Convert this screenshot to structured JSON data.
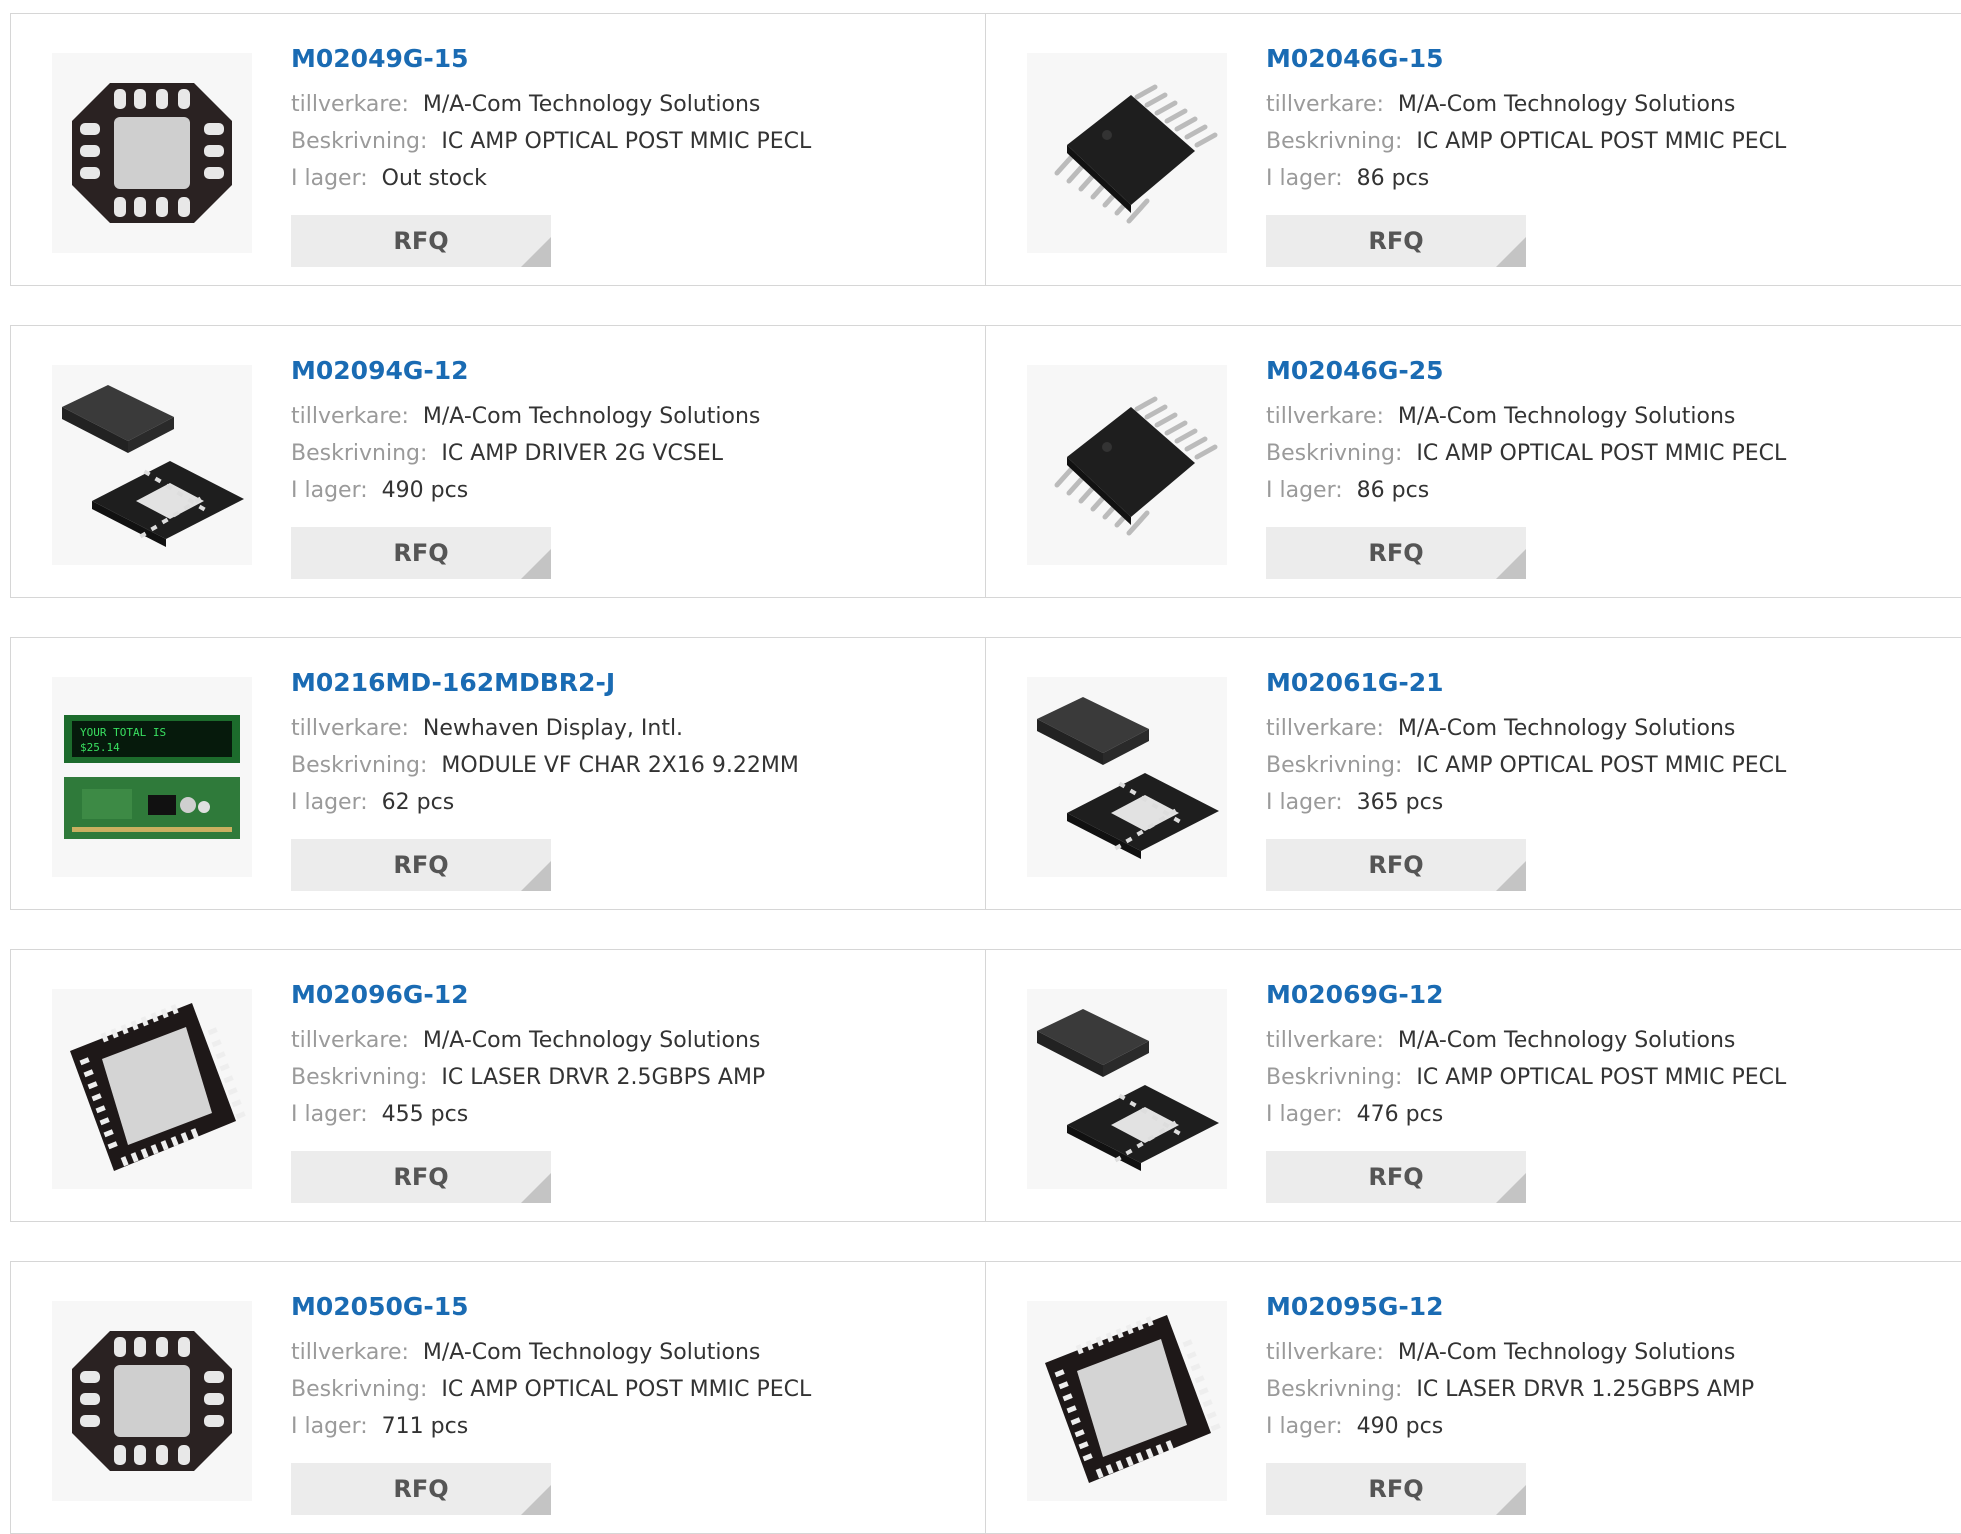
{
  "labels": {
    "manufacturer": "tillverkare:",
    "description": "Beskrivning:",
    "stock": "I lager:",
    "rfq": "RFQ"
  },
  "colors": {
    "part_link": "#1a6bb3",
    "label": "#9a9a9a",
    "button_bg": "#ececec"
  },
  "products": [
    {
      "part": "M02049G-15",
      "manufacturer": "M/A-Com Technology Solutions",
      "description": "IC AMP OPTICAL POST MMIC PECL",
      "stock": "Out stock",
      "image": "qfn-16-chip-icon"
    },
    {
      "part": "M02046G-15",
      "manufacturer": "M/A-Com Technology Solutions",
      "description": "IC AMP OPTICAL POST MMIC PECL",
      "stock": "86 pcs",
      "image": "tssop-chip-icon"
    },
    {
      "part": "M02094G-12",
      "manufacturer": "M/A-Com Technology Solutions",
      "description": "IC AMP DRIVER 2G VCSEL",
      "stock": "490 pcs",
      "image": "qfn-top-bottom-icon"
    },
    {
      "part": "M02046G-25",
      "manufacturer": "M/A-Com Technology Solutions",
      "description": "IC AMP OPTICAL POST MMIC PECL",
      "stock": "86 pcs",
      "image": "tssop-chip-icon"
    },
    {
      "part": "M0216MD-162MDBR2-J",
      "manufacturer": "Newhaven Display, Intl.",
      "description": "MODULE VF CHAR 2X16 9.22MM",
      "stock": "62 pcs",
      "image": "vfd-module-icon",
      "display_text": [
        "YOUR TOTAL IS",
        "$25.14"
      ]
    },
    {
      "part": "M02061G-21",
      "manufacturer": "M/A-Com Technology Solutions",
      "description": "IC AMP OPTICAL POST MMIC PECL",
      "stock": "365 pcs",
      "image": "qfn-top-bottom-icon"
    },
    {
      "part": "M02096G-12",
      "manufacturer": "M/A-Com Technology Solutions",
      "description": "IC LASER DRVR 2.5GBPS AMP",
      "stock": "455 pcs",
      "image": "qfn-32-chip-icon"
    },
    {
      "part": "M02069G-12",
      "manufacturer": "M/A-Com Technology Solutions",
      "description": "IC AMP OPTICAL POST MMIC PECL",
      "stock": "476 pcs",
      "image": "qfn-top-bottom-icon"
    },
    {
      "part": "M02050G-15",
      "manufacturer": "M/A-Com Technology Solutions",
      "description": "IC AMP OPTICAL POST MMIC PECL",
      "stock": "711 pcs",
      "image": "qfn-16-chip-icon"
    },
    {
      "part": "M02095G-12",
      "manufacturer": "M/A-Com Technology Solutions",
      "description": "IC LASER DRVR 1.25GBPS AMP",
      "stock": "490 pcs",
      "image": "qfn-32-chip-icon"
    }
  ]
}
